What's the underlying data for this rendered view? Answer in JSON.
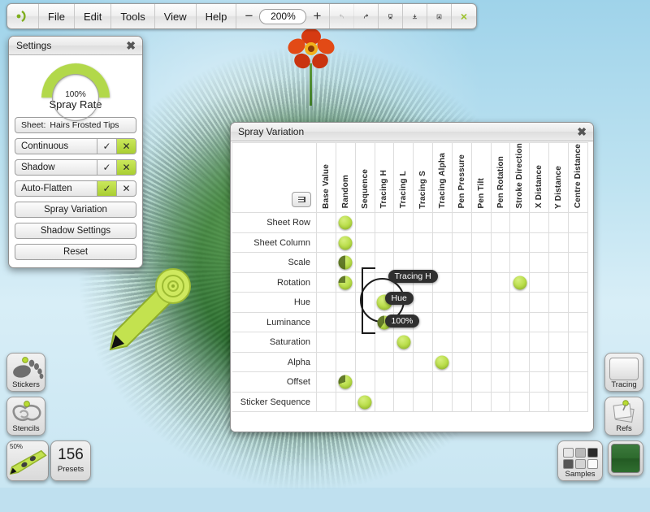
{
  "toolbar": {
    "logo_icon": "app-logo-icon",
    "menus": [
      "File",
      "Edit",
      "Tools",
      "View",
      "Help"
    ],
    "zoom": {
      "minus": "−",
      "value": "200%",
      "plus": "+"
    },
    "icons": [
      {
        "name": "undo-icon",
        "glyph": "↶",
        "enabled": false
      },
      {
        "name": "redo-icon",
        "glyph": "↷",
        "enabled": true
      },
      {
        "name": "easel-icon",
        "glyph": "⛩",
        "enabled": true
      },
      {
        "name": "download-icon",
        "glyph": "⬇",
        "enabled": true
      },
      {
        "name": "frame-icon",
        "glyph": "▣",
        "enabled": true
      },
      {
        "name": "close-green-icon",
        "glyph": "✖",
        "enabled": true
      }
    ]
  },
  "settings": {
    "title": "Settings",
    "close_icon": "close-icon",
    "gauge": {
      "percent": "100%",
      "label": "Spray Rate",
      "color": "#b2d84a"
    },
    "sheet": {
      "key": "Sheet:",
      "value": "Hairs Frosted Tips"
    },
    "toggles": [
      {
        "label": "Continuous",
        "check": "✓",
        "cross": "✕",
        "active": "cross"
      },
      {
        "label": "Shadow",
        "check": "✓",
        "cross": "✕",
        "active": "cross"
      },
      {
        "label": "Auto-Flatten",
        "check": "✓",
        "cross": "✕",
        "active": "check"
      }
    ],
    "buttons": [
      "Spray Variation",
      "Shadow Settings",
      "Reset"
    ]
  },
  "spray": {
    "title": "Spray Variation",
    "close_icon": "close-icon",
    "menu_icon": "list-menu-icon",
    "columns": [
      "Base Value",
      "Random",
      "Sequence",
      "Tracing H",
      "Tracing L",
      "Tracing S",
      "Tracing Alpha",
      "Pen Pressure",
      "Pen Tilt",
      "Pen Rotation",
      "Stroke Direction",
      "X Distance",
      "Y Distance",
      "Centre Distance"
    ],
    "rows": [
      "Sheet Row",
      "Sheet Column",
      "Scale",
      "Rotation",
      "Hue",
      "Luminance",
      "Saturation",
      "Alpha",
      "Offset",
      "Sticker Sequence"
    ],
    "cells": [
      {
        "row": "Sheet Row",
        "col": "Random",
        "fill": 100,
        "selected": false
      },
      {
        "row": "Sheet Column",
        "col": "Random",
        "fill": 100,
        "selected": false
      },
      {
        "row": "Scale",
        "col": "Random",
        "fill": 50,
        "selected": false
      },
      {
        "row": "Rotation",
        "col": "Random",
        "fill": 75,
        "selected": false
      },
      {
        "row": "Rotation",
        "col": "Stroke Direction",
        "fill": 100,
        "selected": false
      },
      {
        "row": "Hue",
        "col": "Tracing H",
        "fill": 100,
        "selected": true
      },
      {
        "row": "Luminance",
        "col": "Tracing H",
        "fill": 60,
        "selected": false
      },
      {
        "row": "Saturation",
        "col": "Tracing L",
        "fill": 100,
        "selected": false
      },
      {
        "row": "Alpha",
        "col": "Tracing Alpha",
        "fill": 100,
        "selected": false
      },
      {
        "row": "Offset",
        "col": "Random",
        "fill": 70,
        "selected": false
      },
      {
        "row": "Sticker Sequence",
        "col": "Sequence",
        "fill": 100,
        "selected": false
      }
    ],
    "tooltips": {
      "column": "Tracing H",
      "row": "Hue",
      "value": "100%"
    }
  },
  "tools": {
    "stickers": {
      "label": "Stickers",
      "icon": "sticker-paw-icon"
    },
    "stencils": {
      "label": "Stencils",
      "icon": "stencil-icon"
    },
    "brush": {
      "label": "",
      "icon": "brush-icon",
      "percent": "50%"
    },
    "presets": {
      "count": "156",
      "label": "Presets"
    },
    "tracing": {
      "label": "Tracing",
      "icon": "tracing-sheet-icon"
    },
    "refs": {
      "label": "Refs",
      "icon": "reference-notes-icon"
    },
    "samples": {
      "label": "Samples",
      "icon": "color-samples-icon",
      "swatches": [
        "#e6e6e6",
        "#b9b9b9",
        "#2a2a2a",
        "#565656",
        "#d4d4d4",
        "#fafafa"
      ]
    },
    "color": {
      "icon": "current-color-swatch",
      "value": "#2e6b2e"
    }
  }
}
